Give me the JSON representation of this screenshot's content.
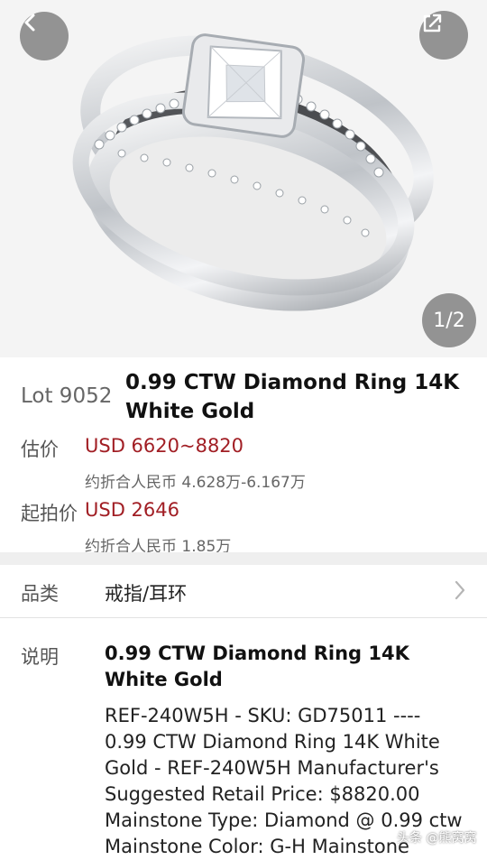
{
  "gallery": {
    "counter": "1/2",
    "image_alt": "diamond bridal ring set",
    "back_icon": "chevron-left-icon",
    "share_icon": "share-icon"
  },
  "lot": {
    "number": "Lot 9052",
    "title": "0.99 CTW Diamond Ring 14K White Gold"
  },
  "estimate": {
    "label": "估价",
    "value": "USD 6620~8820",
    "rmb": "约折合人民币 4.628万-6.167万"
  },
  "starting_bid": {
    "label": "起拍价",
    "value": "USD 2646",
    "rmb": "约折合人民币 1.85万"
  },
  "category": {
    "label": "品类",
    "value": "戒指/耳环",
    "arrow_icon": "chevron-right-icon"
  },
  "description": {
    "label": "说明",
    "title": "0.99 CTW Diamond Ring 14K White Gold",
    "body": "REF-240W5H - SKU: GD75011 ---- 0.99 CTW Diamond Ring 14K White Gold - REF-240W5H Manufacturer's Suggested Retail Price: $8820.00 Mainstone Type: Diamond @ 0.99 ctw Mainstone Color: G-H Mainstone"
  },
  "watermark": "头条 @熊窝窝",
  "colors": {
    "price_red": "#a11e24",
    "divider": "#efefef"
  }
}
